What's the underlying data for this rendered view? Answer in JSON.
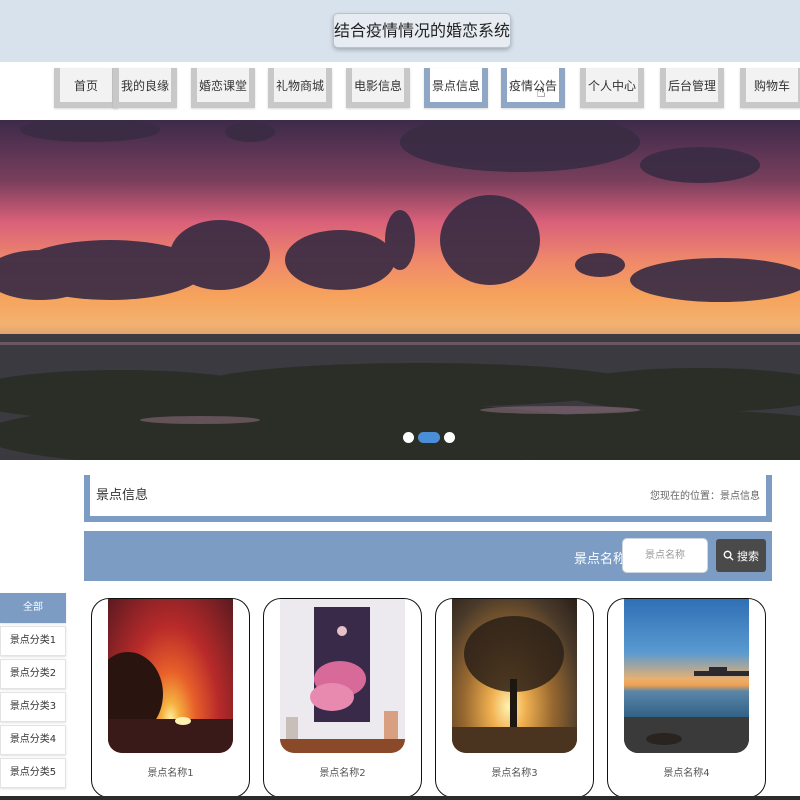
{
  "header": {
    "title": "结合疫情情况的婚恋系统"
  },
  "nav": {
    "items": [
      {
        "label": "首页"
      },
      {
        "label": "我的良缘"
      },
      {
        "label": "婚恋课堂"
      },
      {
        "label": "礼物商城"
      },
      {
        "label": "电影信息"
      },
      {
        "label": "景点信息"
      },
      {
        "label": "疫情公告"
      },
      {
        "label": "个人中心"
      },
      {
        "label": "后台管理"
      },
      {
        "label": "购物车"
      }
    ],
    "active": "景点信息"
  },
  "banner": {
    "slide_count": 3,
    "active_slide": 2
  },
  "section": {
    "title": "景点信息",
    "breadcrumb": "您现在的位置：景点信息"
  },
  "search": {
    "label": "景点名称",
    "placeholder": "景点名称",
    "button_label": "搜索"
  },
  "categories": [
    {
      "label": "全部"
    },
    {
      "label": "景点分类1"
    },
    {
      "label": "景点分类2"
    },
    {
      "label": "景点分类3"
    },
    {
      "label": "景点分类4"
    },
    {
      "label": "景点分类5"
    }
  ],
  "cards": [
    {
      "name": "景点名称1"
    },
    {
      "name": "景点名称2"
    },
    {
      "name": "景点名称3"
    },
    {
      "name": "景点名称4"
    }
  ],
  "colors": {
    "accent": "#7c9cc3",
    "header_bg": "#d8e2ec",
    "dot_active": "#4a8ed8"
  }
}
